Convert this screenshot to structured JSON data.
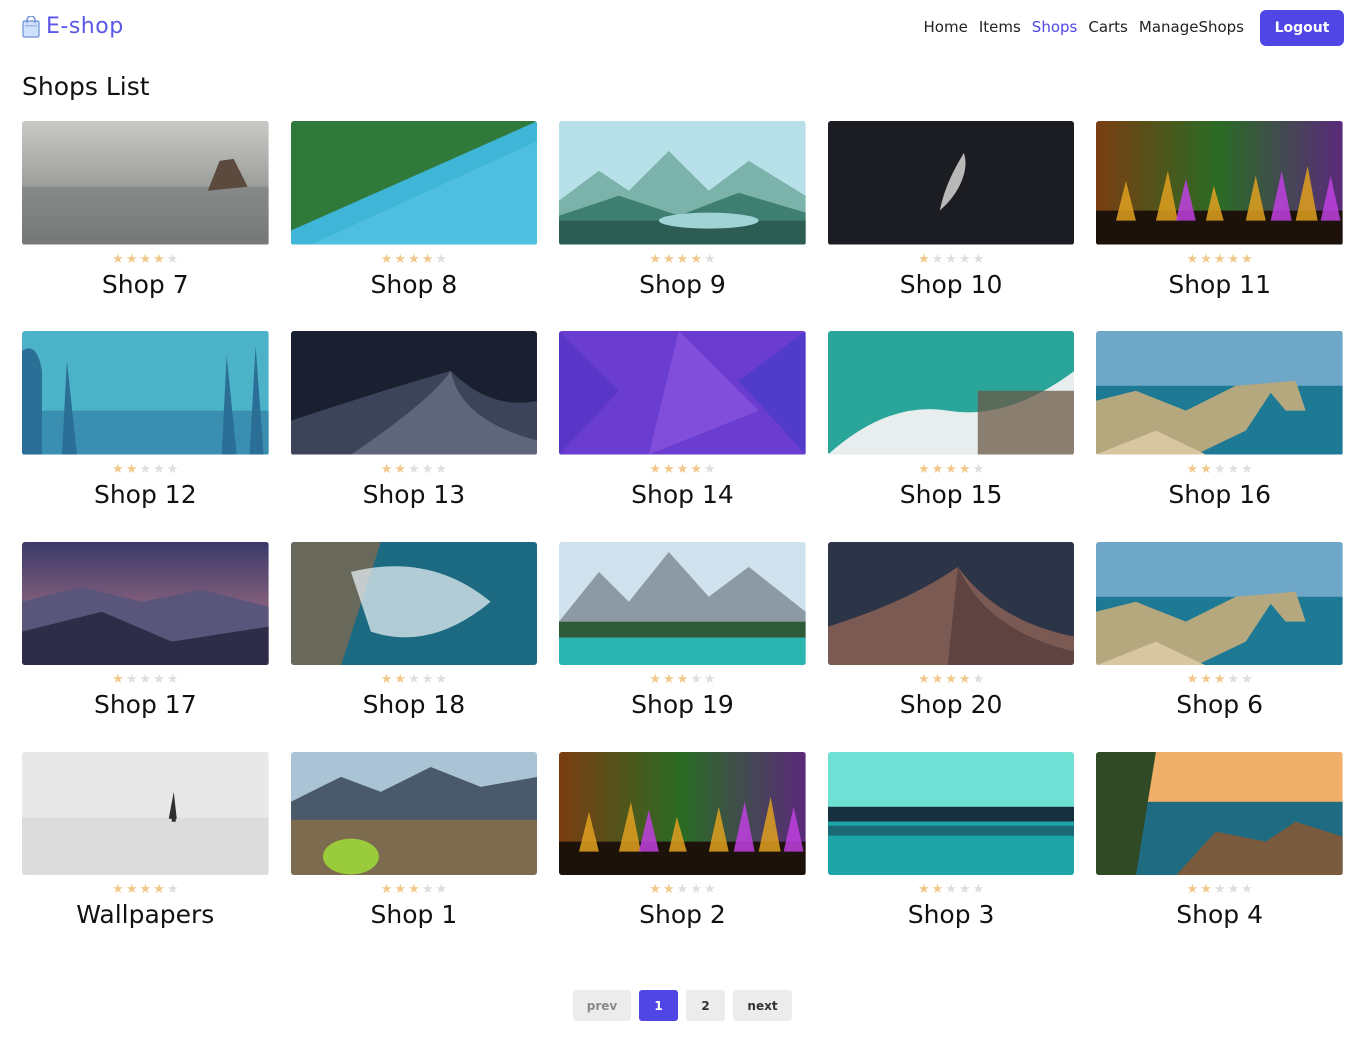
{
  "brand": {
    "name": "E-shop",
    "icon": "shopping-bag-icon",
    "color": "#5a57e6"
  },
  "nav": {
    "items": [
      {
        "label": "Home",
        "active": false
      },
      {
        "label": "Items",
        "active": false
      },
      {
        "label": "Shops",
        "active": true
      },
      {
        "label": "Carts",
        "active": false
      },
      {
        "label": "ManageShops",
        "active": false
      }
    ],
    "logout_label": "Logout",
    "accent_color": "#4f46e5"
  },
  "page": {
    "title": "Shops List"
  },
  "shops": [
    {
      "name": "Shop 7",
      "rating": 4,
      "image": "sea-rock-foggy"
    },
    {
      "name": "Shop 8",
      "rating": 4,
      "image": "forest-lake-aerial"
    },
    {
      "name": "Shop 9",
      "rating": 4,
      "image": "mountains-flat-illustration"
    },
    {
      "name": "Shop 10",
      "rating": 1,
      "image": "feather-dark"
    },
    {
      "name": "Shop 11",
      "rating": 5,
      "image": "crystals-rainbow"
    },
    {
      "name": "Shop 12",
      "rating": 2,
      "image": "teal-forest-illustration"
    },
    {
      "name": "Shop 13",
      "rating": 2,
      "image": "night-dunes"
    },
    {
      "name": "Shop 14",
      "rating": 4,
      "image": "purple-triangles"
    },
    {
      "name": "Shop 15",
      "rating": 4,
      "image": "ocean-waves-rocks"
    },
    {
      "name": "Shop 16",
      "rating": 2,
      "image": "coast-arch"
    },
    {
      "name": "Shop 17",
      "rating": 1,
      "image": "dusk-mountains"
    },
    {
      "name": "Shop 18",
      "rating": 2,
      "image": "sea-foam-aerial"
    },
    {
      "name": "Shop 19",
      "rating": 3,
      "image": "alpine-lake"
    },
    {
      "name": "Shop 20",
      "rating": 4,
      "image": "dune-dusk"
    },
    {
      "name": "Shop 6",
      "rating": 3,
      "image": "coast-arch"
    },
    {
      "name": "Wallpapers",
      "rating": 4,
      "image": "snow-tree"
    },
    {
      "name": "Shop 1",
      "rating": 3,
      "image": "sand-dunes-mountains"
    },
    {
      "name": "Shop 2",
      "rating": 2,
      "image": "crystals-rainbow"
    },
    {
      "name": "Shop 3",
      "rating": 2,
      "image": "teal-lake-trees"
    },
    {
      "name": "Shop 4",
      "rating": 2,
      "image": "coastal-cliffs-sunset"
    }
  ],
  "rating_max": 5,
  "star_colors": {
    "filled": "#f2c88a",
    "empty": "#dedede"
  },
  "pagination": {
    "prev_label": "prev",
    "next_label": "next",
    "pages": [
      "1",
      "2"
    ],
    "current": "1"
  }
}
